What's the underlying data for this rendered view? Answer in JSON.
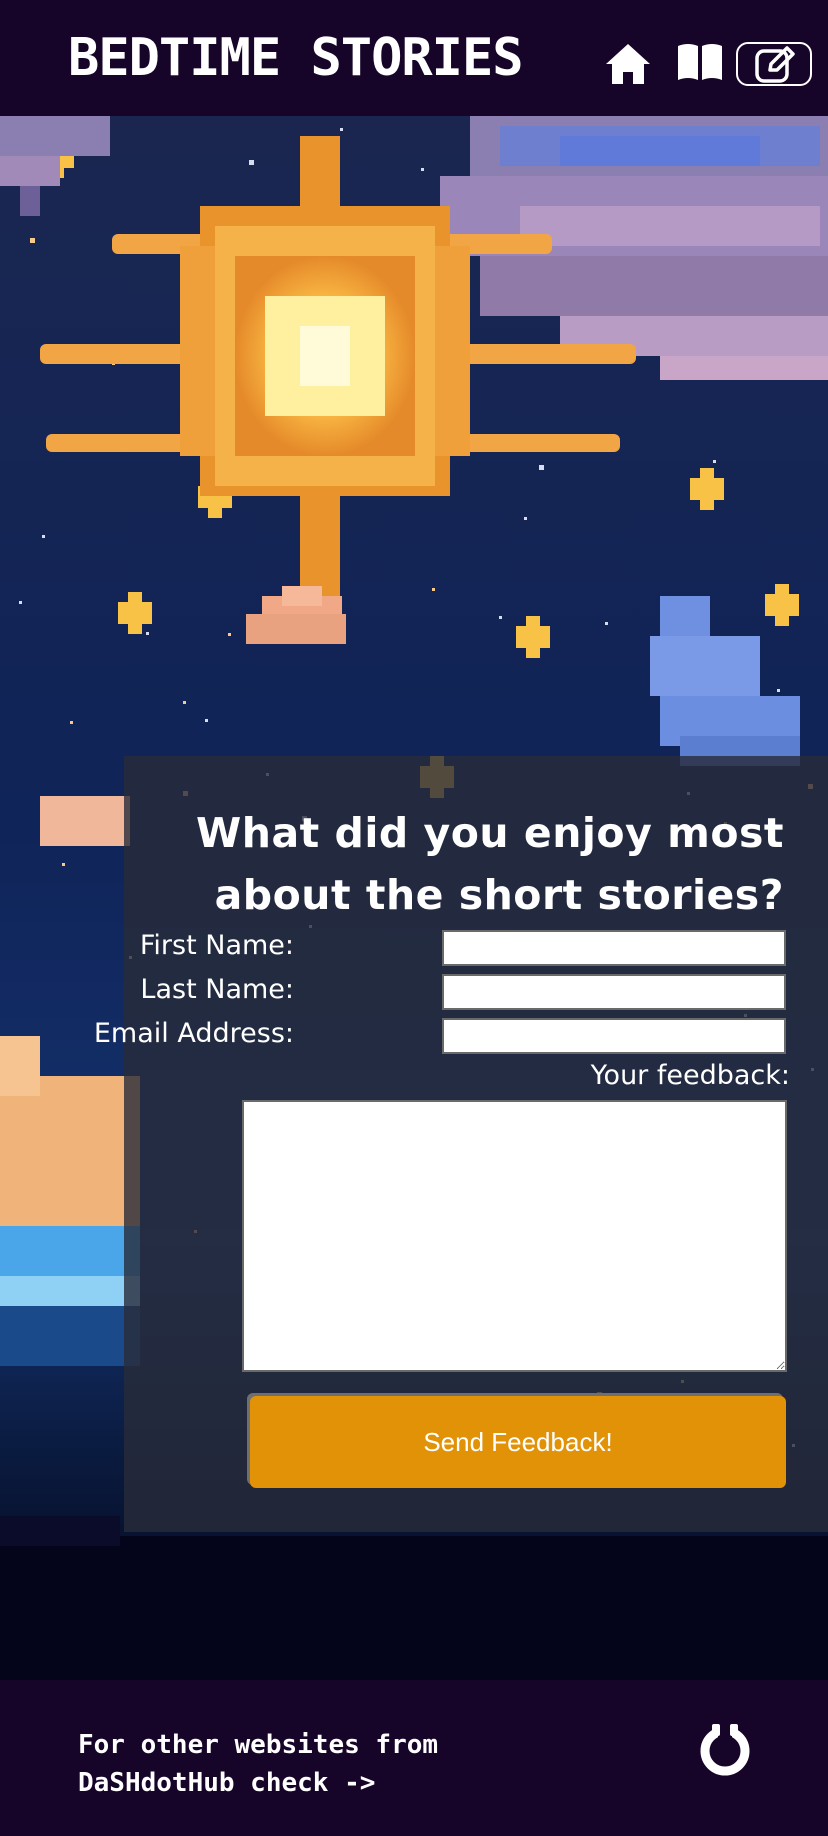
{
  "header": {
    "title": "BEDTIME STORIES",
    "nav": {
      "home": "home-icon",
      "stories": "book-icon",
      "feedback": "edit-icon"
    }
  },
  "form": {
    "question": "What did you enjoy most about the short stories?",
    "first_name_label": "First Name:",
    "last_name_label": "Last Name:",
    "email_label": "Email Address:",
    "feedback_label": "Your feedback:",
    "first_name_value": "",
    "last_name_value": "",
    "email_value": "",
    "feedback_value": "",
    "submit_label": "Send Feedback!"
  },
  "footer": {
    "line1": "For other websites from",
    "line2": "DaSHdotHub check ->",
    "logo": "dashdothub-logo-icon"
  },
  "colors": {
    "header_bg": "#170529",
    "button": "#e29206",
    "panel": "#282c3a"
  }
}
